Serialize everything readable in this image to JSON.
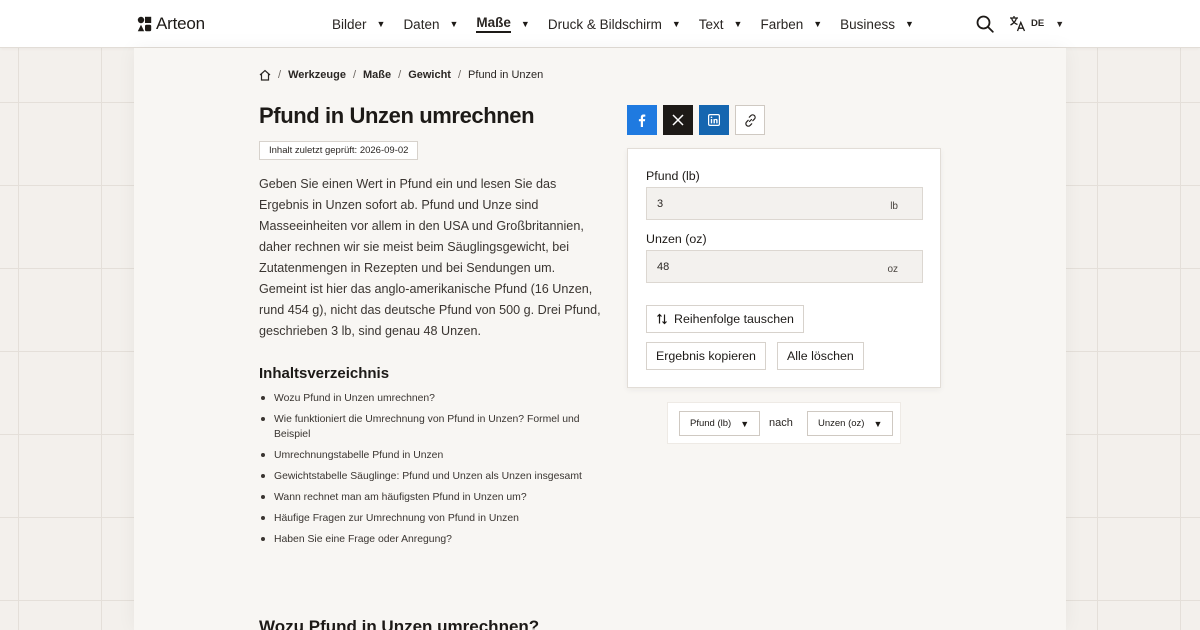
{
  "header": {
    "brand": "Arteon",
    "nav": [
      {
        "label": "Bilder",
        "active": false
      },
      {
        "label": "Daten",
        "active": false
      },
      {
        "label": "Maße",
        "active": true
      },
      {
        "label": "Druck & Bildschirm",
        "active": false
      },
      {
        "label": "Text",
        "active": false
      },
      {
        "label": "Farben",
        "active": false
      },
      {
        "label": "Business",
        "active": false
      }
    ],
    "language": "DE",
    "icons": {
      "search": "search-icon",
      "translate": "translate-icon",
      "home": "home-icon"
    }
  },
  "breadcrumb": {
    "items": [
      "Werkzeuge",
      "Maße",
      "Gewicht"
    ],
    "current": "Pfund in Unzen"
  },
  "article": {
    "title": "Pfund in Unzen umrechnen",
    "reviewed": "Inhalt zuletzt geprüft: 2026-09-02",
    "intro": "Geben Sie einen Wert in Pfund ein und lesen Sie das Ergebnis in Unzen sofort ab. Pfund und Unze sind Masseeinheiten vor allem in den USA und Großbritannien, daher rechnen wir sie meist beim Säuglingsgewicht, bei Zutatenmengen in Rezepten und bei Sendungen um. Gemeint ist hier das anglo-amerikanische Pfund (16 Unzen, rund 454 g), nicht das deutsche Pfund von 500 g. Drei Pfund, geschrieben 3 lb, sind genau 48 Unzen.",
    "toc_title": "Inhaltsverzeichnis",
    "toc": [
      "Wozu Pfund in Unzen umrechnen?",
      "Wie funktioniert die Umrechnung von Pfund in Unzen? Formel und Beispiel",
      "Umrechnungstabelle Pfund in Unzen",
      "Gewichtstabelle Säuglinge: Pfund und Unzen als Unzen insgesamt",
      "Wann rechnet man am häufigsten Pfund in Unzen um?",
      "Häufige Fragen zur Umrechnung von Pfund in Unzen",
      "Haben Sie eine Frage oder Anregung?"
    ],
    "next_section": "Wozu Pfund in Unzen umrechnen?"
  },
  "share": {
    "facebook": "facebook-icon",
    "x": "x-icon",
    "linkedin": "linkedin-icon",
    "link": "link-icon"
  },
  "converter": {
    "from_label": "Pfund (lb)",
    "from_value": "3",
    "from_unit": "lb",
    "to_label": "Unzen (oz)",
    "to_value": "48",
    "to_unit": "oz",
    "swap_label": "Reihenfolge tauschen",
    "copy_label": "Ergebnis kopieren",
    "clear_label": "Alle löschen"
  },
  "unit_selector": {
    "from": "Pfund (lb)",
    "connector": "nach",
    "to": "Unzen (oz)"
  },
  "colors": {
    "facebook": "#1f7ae0",
    "x": "#1d1a17",
    "linkedin": "#1566b0",
    "panel_bg": "#f8f6f3",
    "page_bg": "#f3f0ec"
  }
}
